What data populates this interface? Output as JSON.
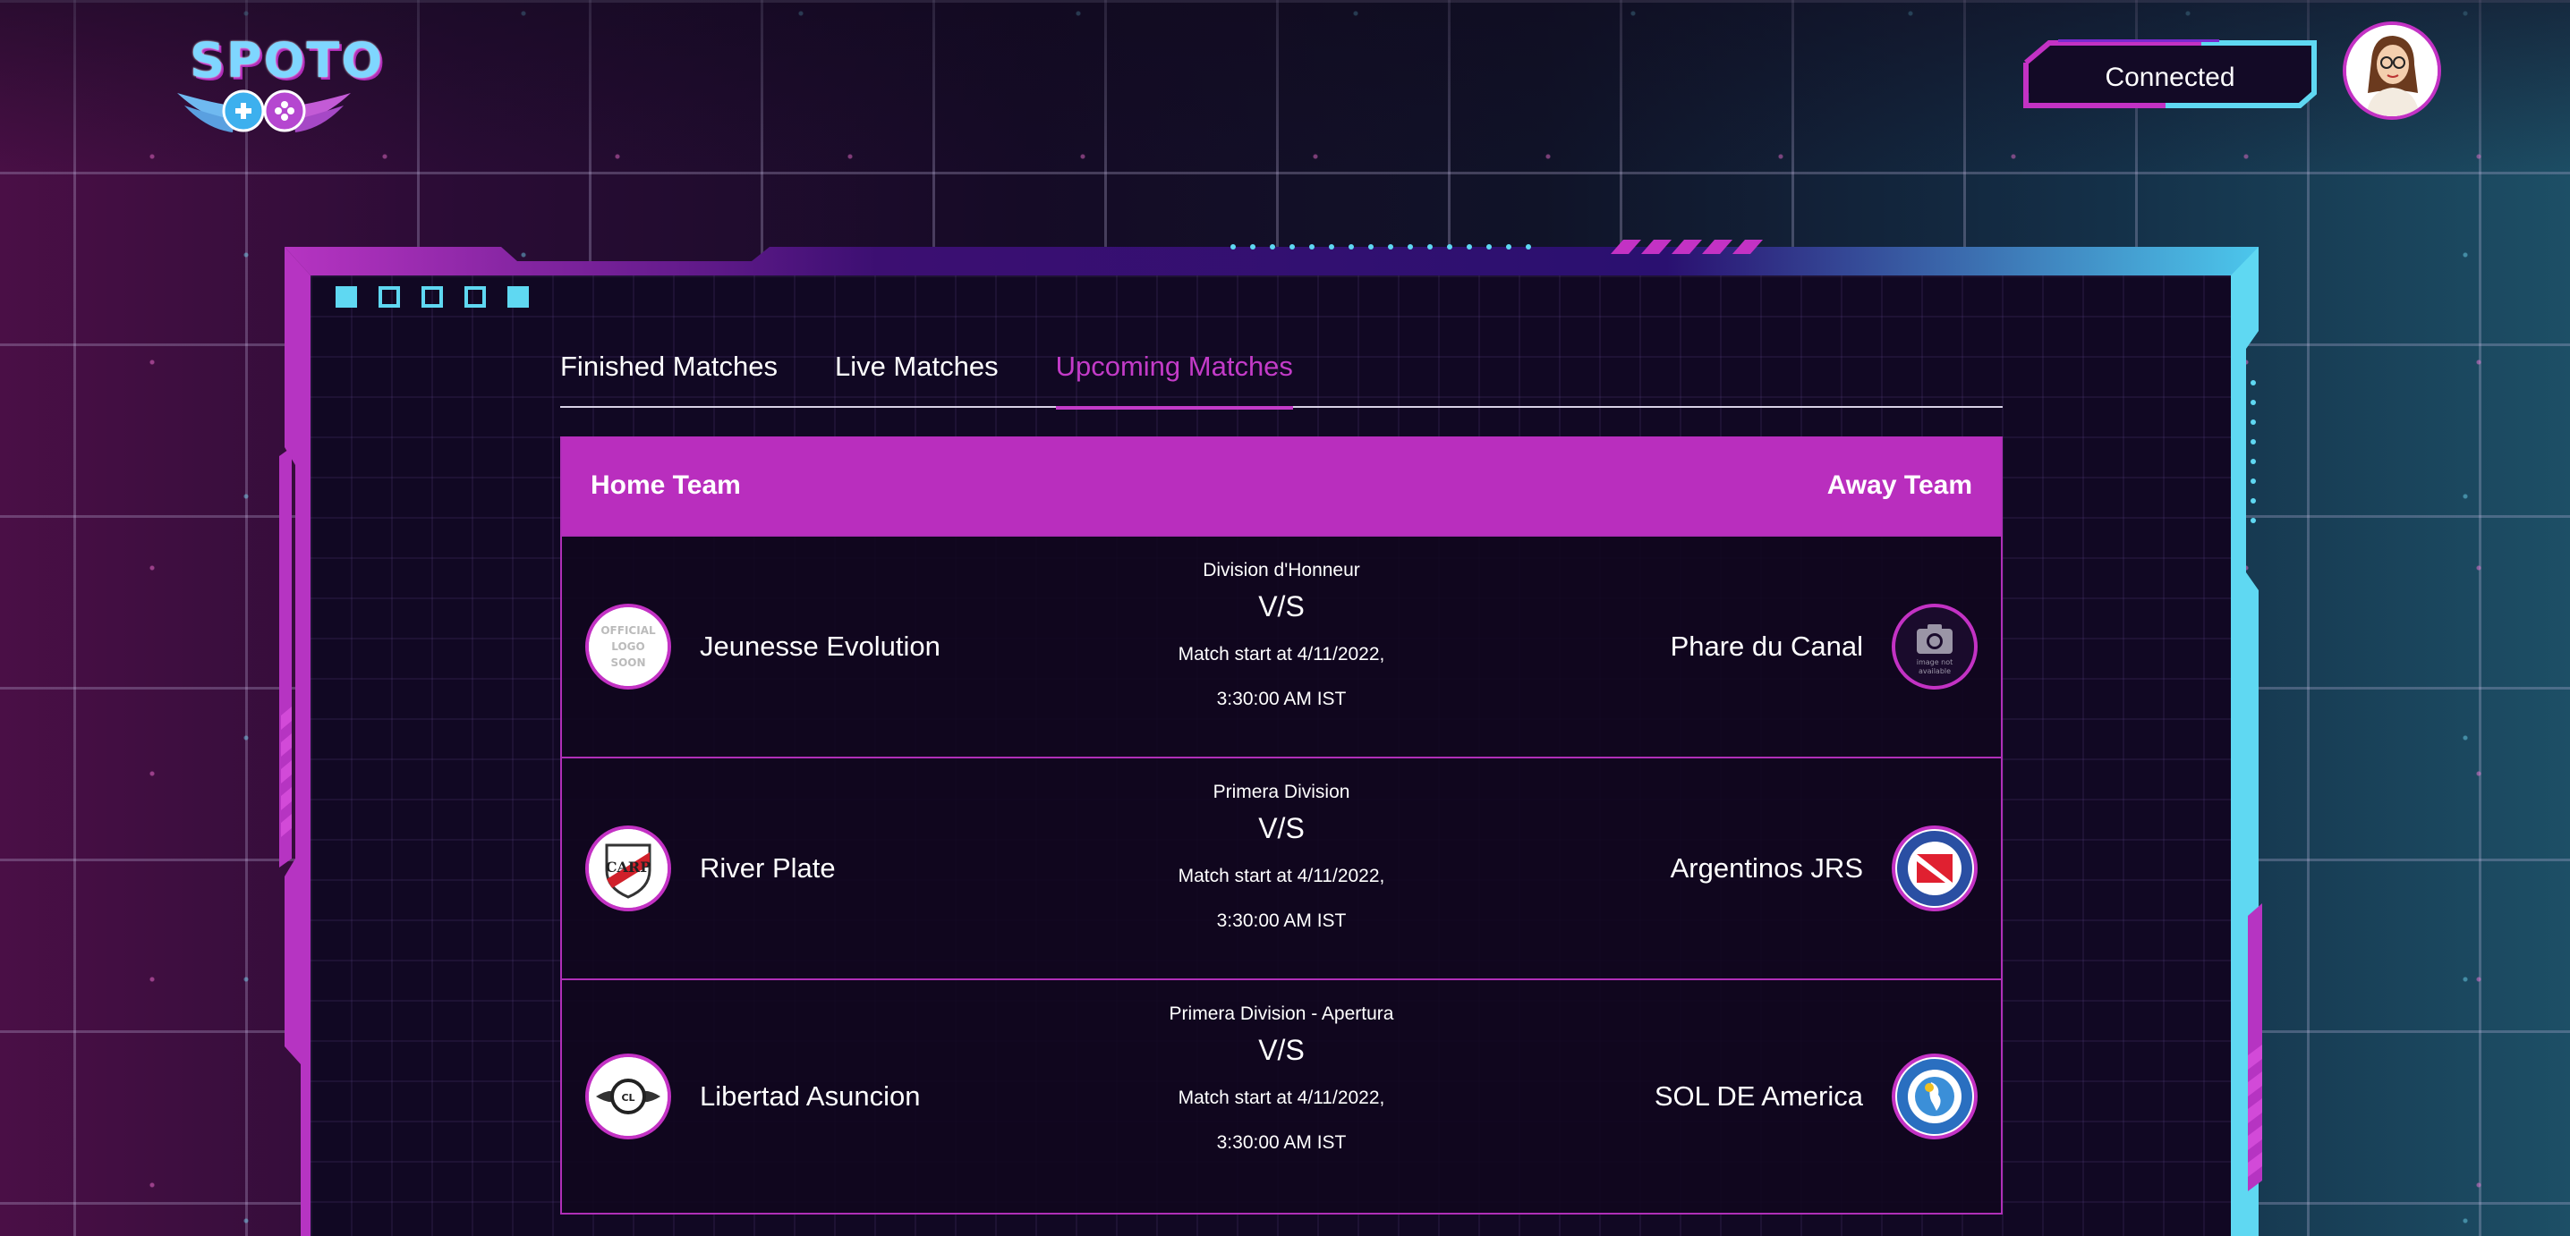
{
  "app": {
    "logo_text": "SPOTO"
  },
  "header": {
    "status_label": "Connected"
  },
  "tabs": [
    {
      "label": "Finished Matches",
      "active": false
    },
    {
      "label": "Live Matches",
      "active": false
    },
    {
      "label": "Upcoming Matches",
      "active": true
    }
  ],
  "table": {
    "home_header": "Home Team",
    "away_header": "Away Team",
    "vs_label": "V/S",
    "rows": [
      {
        "home": "Jeunesse Evolution",
        "away": "Phare du Canal",
        "league": "Division d'Honneur",
        "start_line1": "Match start at 4/11/2022,",
        "start_line2": "3:30:00 AM IST",
        "home_logo_text": "OFFICIAL LOGO SOON",
        "away_logo_text": "image not available"
      },
      {
        "home": "River Plate",
        "away": "Argentinos JRS",
        "league": "Primera Division",
        "start_line1": "Match start at 4/11/2022,",
        "start_line2": "3:30:00 AM IST"
      },
      {
        "home": "Libertad Asuncion",
        "away": "SOL DE America",
        "league": "Primera Division - Apertura",
        "start_line1": "Match start at 4/11/2022,",
        "start_line2": "3:30:00 AM IST"
      }
    ]
  },
  "colors": {
    "accent_magenta": "#c33bc8",
    "header_magenta": "#b92ebe",
    "accent_cyan": "#5fd8f2",
    "panel_bg": "#110823"
  }
}
